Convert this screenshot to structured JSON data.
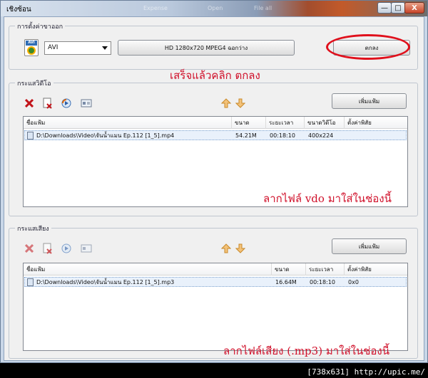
{
  "window": {
    "title": "เชิงซ้อน",
    "ghost_tabs": [
      "Expense",
      "Open",
      "File all"
    ],
    "min_label": "—",
    "max_label": "□",
    "close_label": "X"
  },
  "output": {
    "group_label": "การตั้งค่าขาออก",
    "format_icon": "avi-file-icon",
    "format_value": "AVI",
    "profile_label": "HD 1280x720 MPEG4  ฉอกว่าง",
    "ok_label": "ตกลง"
  },
  "video": {
    "group_label": "กระแสวิดีโอ",
    "add_label": "เพิ่มแฟ้ม",
    "columns": [
      "ชื่อแฟ้ม",
      "ขนาด",
      "ระยะเวลา",
      "ขนาดวิดีโอ",
      "ตั้งค่าพิสัย"
    ],
    "rows": [
      {
        "name": "D:\\Downloads\\Video\\จันน้ำแมน Ep.112 [1_5].mp4",
        "size": "54.21M",
        "duration": "00:18:10",
        "resolution": "400x224",
        "range": ""
      }
    ]
  },
  "audio": {
    "group_label": "กระแสเสียง",
    "add_label": "เพิ่มแฟ้ม",
    "columns": [
      "ชื่อแฟ้ม",
      "ขนาด",
      "ระยะเวลา",
      "ตั้งค่าพิสัย"
    ],
    "rows": [
      {
        "name": "D:\\Downloads\\Video\\จันน้ำแมน Ep.112 [1_5].mp3",
        "size": "16.64M",
        "duration": "00:18:10",
        "range": "0x0"
      }
    ]
  },
  "annotations": {
    "click_ok": "เสร็จแล้วคลิก ตกลง",
    "drop_video": "ลากไฟล์ vdo มาใส่ในช่องนี้",
    "drop_audio": "ลากไฟล์เสียง (.mp3) มาใส่ในช่องนี้"
  },
  "credit": "[738x631] http://upic.me/",
  "colors": {
    "annotation": "#d0102a",
    "selection": "#e9f1fb"
  }
}
